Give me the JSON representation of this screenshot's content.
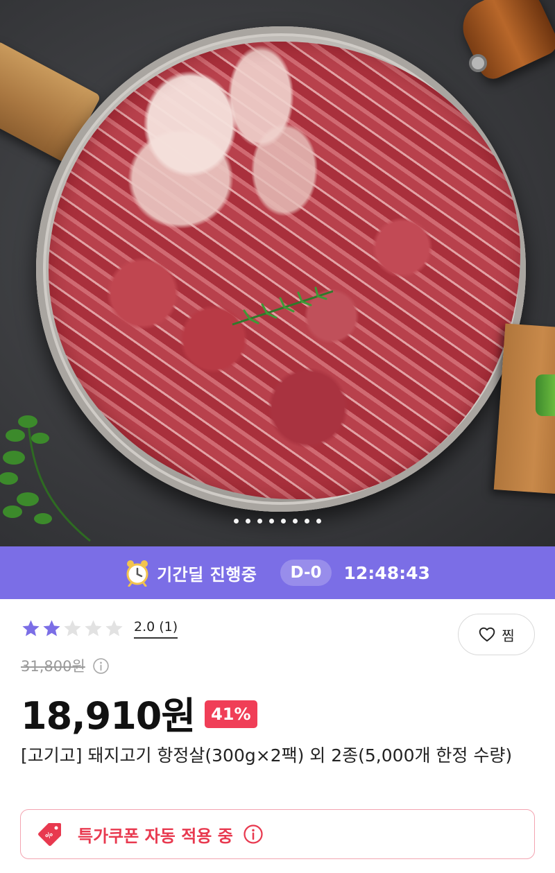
{
  "hero": {
    "image_alt": "pork neck meat on a pan",
    "carousel_dots": 8
  },
  "deal": {
    "label": "기간딜 진행중",
    "dday": "D-0",
    "timer": "12:48:43",
    "icon": "alarm-clock-icon",
    "bg_color": "#7b6ee6"
  },
  "rating": {
    "stars_filled": 2,
    "stars_total": 5,
    "text": "2.0 (1)",
    "star_color": "#7b6ee6"
  },
  "wishlist": {
    "label": "찜",
    "icon": "heart-icon"
  },
  "pricing": {
    "original_price": "31,800원",
    "price": "18,910원",
    "discount": "41%",
    "discount_color": "#f03e57"
  },
  "product": {
    "name": "[고기고] 돼지고기 항정살(300g×2팩) 외 2종(5,000개 한정 수량)"
  },
  "coupon": {
    "label": "특가쿠폰 자동 적용 중",
    "icon": "coupon-tag-icon",
    "accent_color": "#e8394f"
  }
}
